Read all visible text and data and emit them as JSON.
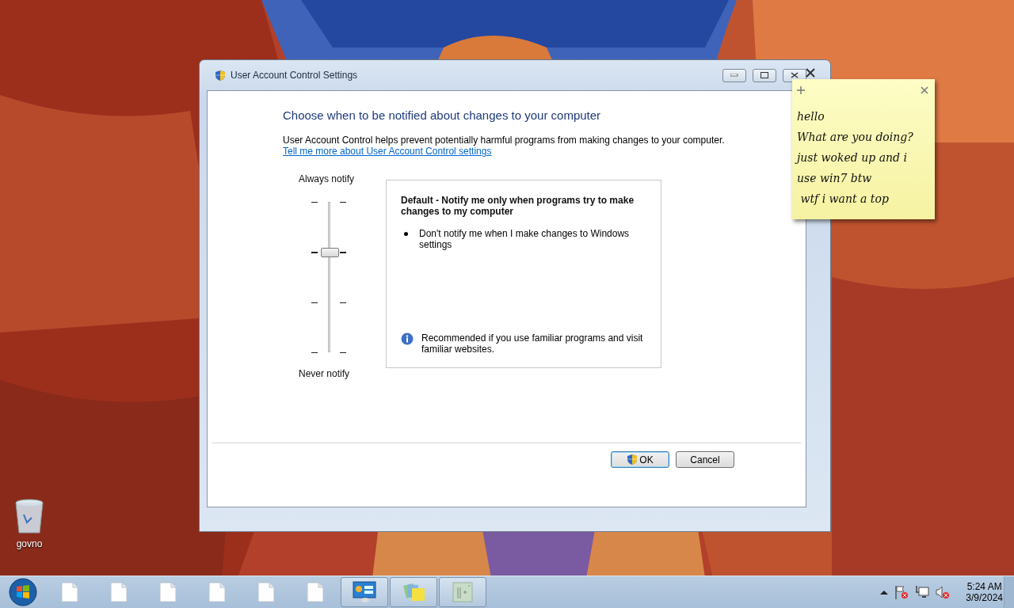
{
  "desktop": {
    "icons": [
      {
        "label": "govno",
        "kind": "recycle-bin"
      }
    ]
  },
  "window": {
    "title": "User Account Control Settings",
    "heading": "Choose when to be notified about changes to your computer",
    "description": "User Account Control helps prevent potentially harmful programs from making changes to your computer.",
    "link": "Tell me more about User Account Control settings",
    "slider": {
      "top_label": "Always notify",
      "bottom_label": "Never notify",
      "steps": [
        {
          "selected": false
        },
        {
          "selected": true
        },
        {
          "selected": false
        },
        {
          "selected": false
        }
      ]
    },
    "panel": {
      "title": "Default - Notify me only when programs try to make changes to my computer",
      "bullets": [
        "Don't notify me when I make changes to Windows settings"
      ],
      "recommendation": "Recommended if you use familiar programs and visit familiar websites."
    },
    "buttons": [
      {
        "label": "OK",
        "shield": true,
        "default": true
      },
      {
        "label": "Cancel",
        "shield": false,
        "default": false
      }
    ]
  },
  "sticky_note": {
    "lines": [
      "hello",
      "What are you doing?",
      "just woked up and i",
      "use win7 btw",
      " wtf i want a top"
    ]
  },
  "taskbar": {
    "items": [
      {
        "kind": "document",
        "running": false
      },
      {
        "kind": "document",
        "running": false
      },
      {
        "kind": "document",
        "running": false
      },
      {
        "kind": "document",
        "running": false
      },
      {
        "kind": "document",
        "running": false
      },
      {
        "kind": "document",
        "running": false
      },
      {
        "kind": "control-panel",
        "running": true
      },
      {
        "kind": "sticky-notes",
        "running": true
      },
      {
        "kind": "chart",
        "running": true
      }
    ],
    "time": "5:24 AM",
    "date": "3/9/2024"
  }
}
